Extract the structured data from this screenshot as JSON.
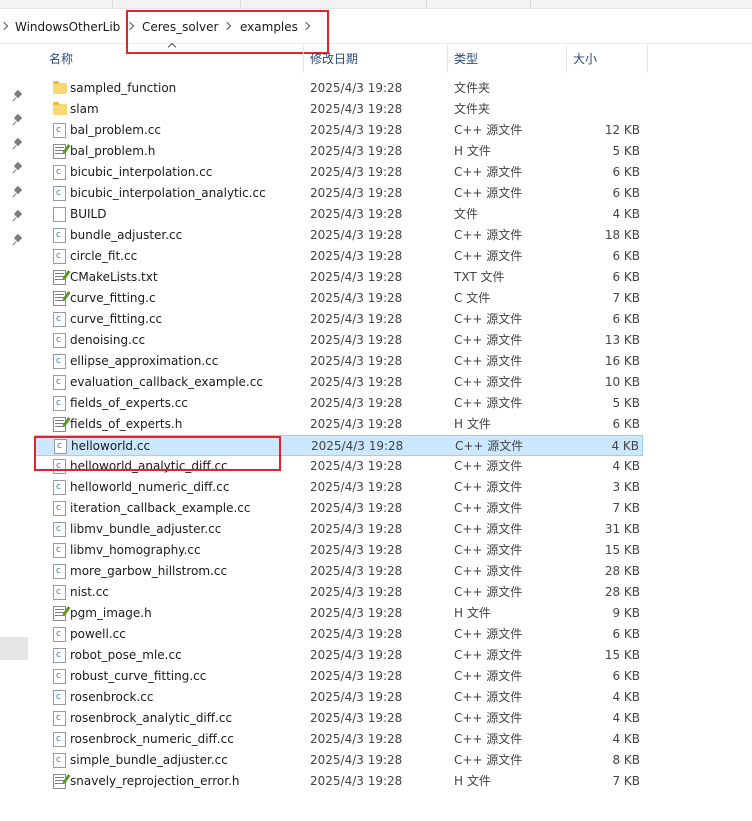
{
  "breadcrumb": {
    "items": [
      "WindowsOtherLib",
      "Ceres_solver",
      "examples"
    ]
  },
  "columns": {
    "name": "名称",
    "date": "修改日期",
    "type": "类型",
    "size": "大小"
  },
  "files": [
    {
      "name": "sampled_function",
      "date": "2025/4/3 19:28",
      "type": "文件夹",
      "size": "",
      "icon": "folder-icon"
    },
    {
      "name": "slam",
      "date": "2025/4/3 19:28",
      "type": "文件夹",
      "size": "",
      "icon": "folder-icon"
    },
    {
      "name": "bal_problem.cc",
      "date": "2025/4/3 19:28",
      "type": "C++ 源文件",
      "size": "12 KB",
      "icon": "cpp-file-icon"
    },
    {
      "name": "bal_problem.h",
      "date": "2025/4/3 19:28",
      "type": "H 文件",
      "size": "5 KB",
      "icon": "header-file-icon"
    },
    {
      "name": "bicubic_interpolation.cc",
      "date": "2025/4/3 19:28",
      "type": "C++ 源文件",
      "size": "6 KB",
      "icon": "cpp-file-icon"
    },
    {
      "name": "bicubic_interpolation_analytic.cc",
      "date": "2025/4/3 19:28",
      "type": "C++ 源文件",
      "size": "6 KB",
      "icon": "cpp-file-icon"
    },
    {
      "name": "BUILD",
      "date": "2025/4/3 19:28",
      "type": "文件",
      "size": "4 KB",
      "icon": "blank-file-icon"
    },
    {
      "name": "bundle_adjuster.cc",
      "date": "2025/4/3 19:28",
      "type": "C++ 源文件",
      "size": "18 KB",
      "icon": "cpp-file-icon"
    },
    {
      "name": "circle_fit.cc",
      "date": "2025/4/3 19:28",
      "type": "C++ 源文件",
      "size": "6 KB",
      "icon": "cpp-file-icon"
    },
    {
      "name": "CMakeLists.txt",
      "date": "2025/4/3 19:28",
      "type": "TXT 文件",
      "size": "6 KB",
      "icon": "text-file-icon"
    },
    {
      "name": "curve_fitting.c",
      "date": "2025/4/3 19:28",
      "type": "C 文件",
      "size": "7 KB",
      "icon": "text-file-icon"
    },
    {
      "name": "curve_fitting.cc",
      "date": "2025/4/3 19:28",
      "type": "C++ 源文件",
      "size": "6 KB",
      "icon": "cpp-file-icon"
    },
    {
      "name": "denoising.cc",
      "date": "2025/4/3 19:28",
      "type": "C++ 源文件",
      "size": "13 KB",
      "icon": "cpp-file-icon"
    },
    {
      "name": "ellipse_approximation.cc",
      "date": "2025/4/3 19:28",
      "type": "C++ 源文件",
      "size": "16 KB",
      "icon": "cpp-file-icon"
    },
    {
      "name": "evaluation_callback_example.cc",
      "date": "2025/4/3 19:28",
      "type": "C++ 源文件",
      "size": "10 KB",
      "icon": "cpp-file-icon"
    },
    {
      "name": "fields_of_experts.cc",
      "date": "2025/4/3 19:28",
      "type": "C++ 源文件",
      "size": "5 KB",
      "icon": "cpp-file-icon"
    },
    {
      "name": "fields_of_experts.h",
      "date": "2025/4/3 19:28",
      "type": "H 文件",
      "size": "6 KB",
      "icon": "header-file-icon"
    },
    {
      "name": "helloworld.cc",
      "date": "2025/4/3 19:28",
      "type": "C++ 源文件",
      "size": "4 KB",
      "icon": "cpp-file-icon",
      "selected": true
    },
    {
      "name": "helloworld_analytic_diff.cc",
      "date": "2025/4/3 19:28",
      "type": "C++ 源文件",
      "size": "4 KB",
      "icon": "cpp-file-icon"
    },
    {
      "name": "helloworld_numeric_diff.cc",
      "date": "2025/4/3 19:28",
      "type": "C++ 源文件",
      "size": "3 KB",
      "icon": "cpp-file-icon"
    },
    {
      "name": "iteration_callback_example.cc",
      "date": "2025/4/3 19:28",
      "type": "C++ 源文件",
      "size": "7 KB",
      "icon": "cpp-file-icon"
    },
    {
      "name": "libmv_bundle_adjuster.cc",
      "date": "2025/4/3 19:28",
      "type": "C++ 源文件",
      "size": "31 KB",
      "icon": "cpp-file-icon"
    },
    {
      "name": "libmv_homography.cc",
      "date": "2025/4/3 19:28",
      "type": "C++ 源文件",
      "size": "15 KB",
      "icon": "cpp-file-icon"
    },
    {
      "name": "more_garbow_hillstrom.cc",
      "date": "2025/4/3 19:28",
      "type": "C++ 源文件",
      "size": "28 KB",
      "icon": "cpp-file-icon"
    },
    {
      "name": "nist.cc",
      "date": "2025/4/3 19:28",
      "type": "C++ 源文件",
      "size": "28 KB",
      "icon": "cpp-file-icon"
    },
    {
      "name": "pgm_image.h",
      "date": "2025/4/3 19:28",
      "type": "H 文件",
      "size": "9 KB",
      "icon": "header-file-icon"
    },
    {
      "name": "powell.cc",
      "date": "2025/4/3 19:28",
      "type": "C++ 源文件",
      "size": "6 KB",
      "icon": "cpp-file-icon"
    },
    {
      "name": "robot_pose_mle.cc",
      "date": "2025/4/3 19:28",
      "type": "C++ 源文件",
      "size": "15 KB",
      "icon": "cpp-file-icon"
    },
    {
      "name": "robust_curve_fitting.cc",
      "date": "2025/4/3 19:28",
      "type": "C++ 源文件",
      "size": "6 KB",
      "icon": "cpp-file-icon"
    },
    {
      "name": "rosenbrock.cc",
      "date": "2025/4/3 19:28",
      "type": "C++ 源文件",
      "size": "4 KB",
      "icon": "cpp-file-icon"
    },
    {
      "name": "rosenbrock_analytic_diff.cc",
      "date": "2025/4/3 19:28",
      "type": "C++ 源文件",
      "size": "4 KB",
      "icon": "cpp-file-icon"
    },
    {
      "name": "rosenbrock_numeric_diff.cc",
      "date": "2025/4/3 19:28",
      "type": "C++ 源文件",
      "size": "4 KB",
      "icon": "cpp-file-icon"
    },
    {
      "name": "simple_bundle_adjuster.cc",
      "date": "2025/4/3 19:28",
      "type": "C++ 源文件",
      "size": "8 KB",
      "icon": "cpp-file-icon"
    },
    {
      "name": "snavely_reprojection_error.h",
      "date": "2025/4/3 19:28",
      "type": "H 文件",
      "size": "7 KB",
      "icon": "header-file-icon"
    }
  ],
  "colors": {
    "selection_bg": "#cce8ff",
    "selection_border": "#99d1ff",
    "annotation_red": "#e0242c",
    "folder": "#f8d775",
    "header_text": "#2a4a7a"
  }
}
